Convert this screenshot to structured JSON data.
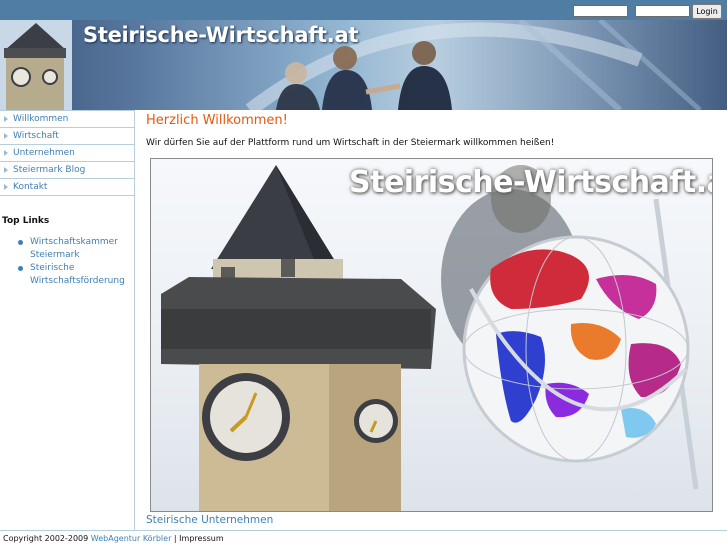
{
  "login": {
    "username_value": "",
    "password_value": "",
    "button_label": "Login"
  },
  "header": {
    "site_title": "Steirische-Wirtschaft.at"
  },
  "nav": {
    "items": [
      {
        "label": "Willkommen"
      },
      {
        "label": "Wirtschaft"
      },
      {
        "label": "Unternehmen"
      },
      {
        "label": "Steiermark Blog"
      },
      {
        "label": "Kontakt"
      }
    ]
  },
  "toplinks": {
    "heading": "Top Links",
    "items": [
      {
        "label": "Wirtschaftskammer Steiermark"
      },
      {
        "label": "Steirische Wirtschaftsförderung"
      }
    ]
  },
  "main": {
    "title": "Herzlich Willkommen!",
    "intro": "Wir dürfen Sie auf der Plattform rund um Wirtschaft in der Steiermark willkommen heißen!",
    "hero_title": "Steirische-Wirtschaft.at",
    "section_link": "Steirische Unternehmen"
  },
  "footer": {
    "copyright": "Copyright 2002-2009",
    "company": "WebAgentur Körbler",
    "separator": "|",
    "impressum": "Impressum"
  },
  "colors": {
    "topbar": "#4f7da3",
    "link": "#3f7fb4",
    "heading_orange": "#e05a10",
    "border": "#b7cfdc"
  },
  "icons": {
    "nav_bullet": "triangle-right-icon",
    "toplink_bullet": "disc-bullet-icon"
  }
}
